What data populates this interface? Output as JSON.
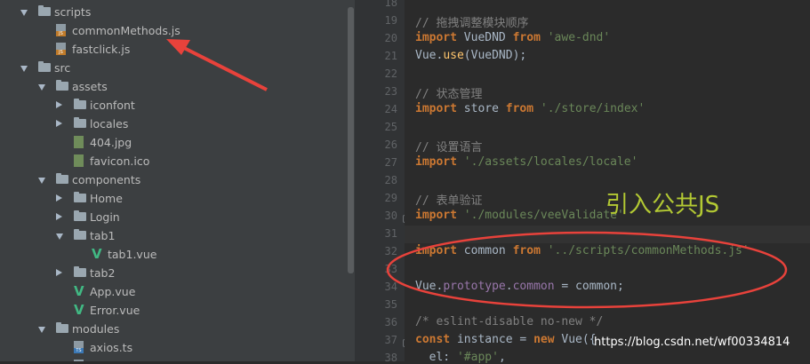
{
  "tree": {
    "rows": [
      {
        "label": "scripts",
        "kind": "folder",
        "state": "open",
        "depth": 1
      },
      {
        "label": "commonMethods.js",
        "kind": "js",
        "depth": 2
      },
      {
        "label": "fastclick.js",
        "kind": "js",
        "depth": 2
      },
      {
        "label": "src",
        "kind": "folder",
        "state": "open",
        "depth": 1
      },
      {
        "label": "assets",
        "kind": "folder",
        "state": "open",
        "depth": 2
      },
      {
        "label": "iconfont",
        "kind": "folder",
        "state": "closed",
        "depth": 3
      },
      {
        "label": "locales",
        "kind": "folder",
        "state": "closed",
        "depth": 3
      },
      {
        "label": "404.jpg",
        "kind": "img",
        "depth": 3
      },
      {
        "label": "favicon.ico",
        "kind": "img",
        "depth": 3
      },
      {
        "label": "components",
        "kind": "folder",
        "state": "open",
        "depth": 2
      },
      {
        "label": "Home",
        "kind": "folder",
        "state": "closed",
        "depth": 3
      },
      {
        "label": "Login",
        "kind": "folder",
        "state": "closed",
        "depth": 3
      },
      {
        "label": "tab1",
        "kind": "folder",
        "state": "open",
        "depth": 3
      },
      {
        "label": "tab1.vue",
        "kind": "vue",
        "depth": 4
      },
      {
        "label": "tab2",
        "kind": "folder",
        "state": "closed",
        "depth": 3
      },
      {
        "label": "App.vue",
        "kind": "vue",
        "depth": 3
      },
      {
        "label": "Error.vue",
        "kind": "vue",
        "depth": 3
      },
      {
        "label": "modules",
        "kind": "folder",
        "state": "open",
        "depth": 2
      },
      {
        "label": "axios.ts",
        "kind": "ts",
        "depth": 3
      },
      {
        "label": "",
        "kind": "ts",
        "depth": 3
      }
    ]
  },
  "editor": {
    "line_numbers": [
      "18",
      "19",
      "20",
      "21",
      "22",
      "23",
      "24",
      "25",
      "26",
      "27",
      "28",
      "29",
      "30",
      "31",
      "32",
      "33",
      "34",
      "35",
      "36",
      "37",
      "38"
    ],
    "lines": [
      [],
      [
        {
          "t": "// 拖拽调整模块顺序",
          "c": "cm"
        }
      ],
      [
        {
          "t": "import",
          "c": "kw"
        },
        {
          "t": " VueDND ",
          "c": ""
        },
        {
          "t": "from",
          "c": "kw"
        },
        {
          "t": " 'awe-dnd'",
          "c": "str"
        }
      ],
      [
        {
          "t": "Vue.",
          "c": ""
        },
        {
          "t": "use",
          "c": "fn"
        },
        {
          "t": "(VueDND);",
          "c": ""
        }
      ],
      [],
      [
        {
          "t": "// 状态管理",
          "c": "cm"
        }
      ],
      [
        {
          "t": "import",
          "c": "kw"
        },
        {
          "t": " store ",
          "c": ""
        },
        {
          "t": "from",
          "c": "kw"
        },
        {
          "t": " './store/index'",
          "c": "str"
        }
      ],
      [],
      [
        {
          "t": "// 设置语言",
          "c": "cm"
        }
      ],
      [
        {
          "t": "import",
          "c": "kw"
        },
        {
          "t": " './assets/locales/locale'",
          "c": "str"
        }
      ],
      [],
      [
        {
          "t": "// 表单验证",
          "c": "cm"
        }
      ],
      [
        {
          "t": "import",
          "c": "kw"
        },
        {
          "t": " './modules/veeValidate'",
          "c": "str"
        }
      ],
      [],
      [
        {
          "t": "import",
          "c": "kw"
        },
        {
          "t": " common ",
          "c": ""
        },
        {
          "t": "from",
          "c": "kw"
        },
        {
          "t": " '../scripts/commonMethods.js'",
          "c": "str"
        }
      ],
      [],
      [
        {
          "t": "Vue.",
          "c": ""
        },
        {
          "t": "prototype",
          "c": "prop"
        },
        {
          "t": ".",
          "c": ""
        },
        {
          "t": "common",
          "c": "prop"
        },
        {
          "t": " = common;",
          "c": ""
        }
      ],
      [],
      [
        {
          "t": "/* eslint-disable no-new */",
          "c": "cm"
        }
      ],
      [
        {
          "t": "const",
          "c": "kw"
        },
        {
          "t": " instance = ",
          "c": ""
        },
        {
          "t": "new",
          "c": "kw"
        },
        {
          "t": " Vue({",
          "c": ""
        }
      ],
      [
        {
          "t": "  el: ",
          "c": ""
        },
        {
          "t": "'#app'",
          "c": "str"
        },
        {
          "t": ",",
          "c": ""
        }
      ]
    ],
    "annotation": "引入公共JS",
    "watermark": "https://blog.csdn.net/wf00334814"
  },
  "colors": {
    "arrow": "#e8423b",
    "ellipse": "#e8423b",
    "annotation": "#b3c933"
  }
}
